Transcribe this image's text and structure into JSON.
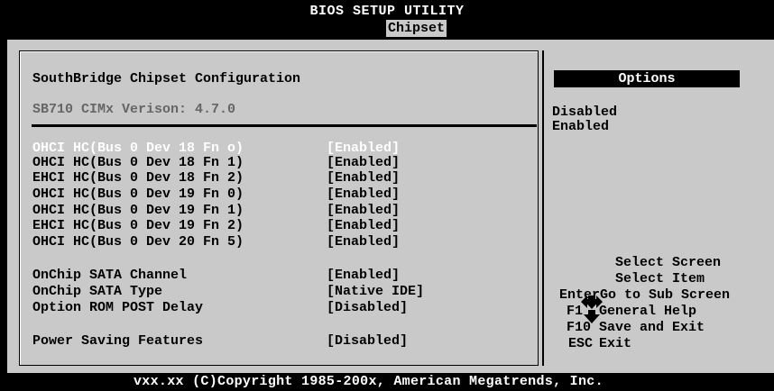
{
  "header": {
    "title": "BIOS SETUP UTILITY",
    "active_tab": "Chipset"
  },
  "main": {
    "section_title": "SouthBridge Chipset Configuration",
    "version_line": "SB710 CIMx Verison: 4.7.0",
    "settings": [
      {
        "label": "OHCI HC(Bus 0 Dev 18 Fn o)",
        "value": "[Enabled]",
        "highlighted": true
      },
      {
        "label": "OHCI HC(Bus 0 Dev 18 Fn 1)",
        "value": "[Enabled]"
      },
      {
        "label": "EHCI HC(Bus 0 Dev 18 Fn 2)",
        "value": "[Enabled]"
      },
      {
        "label": "OHCI HC(Bus 0 Dev 19 Fn 0)",
        "value": "[Enabled]"
      },
      {
        "label": "OHCI HC(Bus 0 Dev 19 Fn 1)",
        "value": "[Enabled]"
      },
      {
        "label": "EHCI HC(Bus 0 Dev 19 Fn 2)",
        "value": "[Enabled]"
      },
      {
        "label": "OHCI HC(Bus 0 Dev 20 Fn 5)",
        "value": "[Enabled]"
      },
      {
        "label": "OnChip SATA Channel",
        "value": "[Enabled]"
      },
      {
        "label": "OnChip SATA Type",
        "value": "[Native IDE]"
      },
      {
        "label": "Option ROM POST Delay",
        "value": "[Disabled]"
      },
      {
        "label": "Power Saving Features",
        "value": "[Disabled]"
      }
    ]
  },
  "options_panel": {
    "header": "Options",
    "items": [
      "Disabled",
      "Enabled"
    ]
  },
  "help": {
    "select_screen": "Select Screen",
    "select_item": "Select Item",
    "rows": [
      {
        "key": "Enter",
        "desc": "Go to Sub Screen"
      },
      {
        "key": "F1",
        "desc": "General Help"
      },
      {
        "key": "F10",
        "desc": "Save and Exit"
      },
      {
        "key": "ESC",
        "desc": "Exit"
      }
    ],
    "arrow_icon": "nav-arrows-icon"
  },
  "footer": {
    "copyright": "vxx.xx (C)Copyright 1985-200x, American Megatrends, Inc."
  },
  "colors": {
    "background": "#c9c9c9",
    "frame": "#000000",
    "highlight_text": "#ffffff",
    "dim_text": "#666666"
  }
}
